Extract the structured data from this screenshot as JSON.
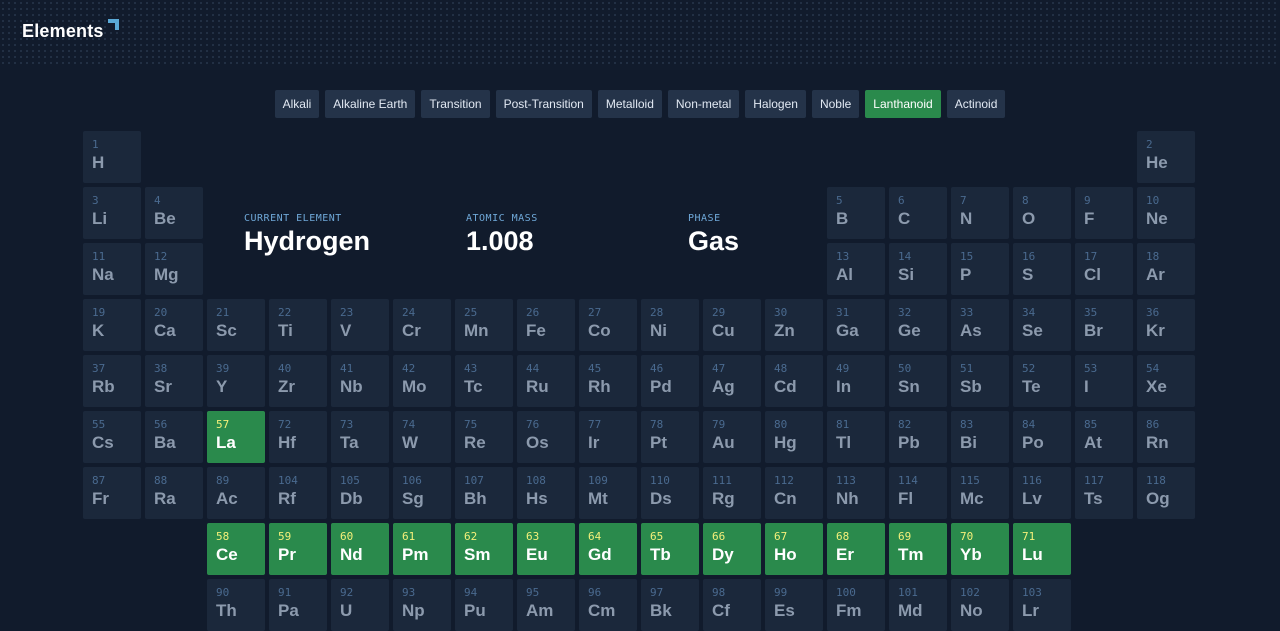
{
  "header": {
    "logo_text": "Elements"
  },
  "filters": [
    {
      "label": "Alkali",
      "active": false
    },
    {
      "label": "Alkaline Earth",
      "active": false
    },
    {
      "label": "Transition",
      "active": false
    },
    {
      "label": "Post-Transition",
      "active": false
    },
    {
      "label": "Metalloid",
      "active": false
    },
    {
      "label": "Non-metal",
      "active": false
    },
    {
      "label": "Halogen",
      "active": false
    },
    {
      "label": "Noble",
      "active": false
    },
    {
      "label": "Lanthanoid",
      "active": true
    },
    {
      "label": "Actinoid",
      "active": false
    }
  ],
  "current": {
    "element_label": "CURRENT ELEMENT",
    "element_value": "Hydrogen",
    "mass_label": "ATOMIC MASS",
    "mass_value": "1.008",
    "phase_label": "PHASE",
    "phase_value": "Gas"
  },
  "colors": {
    "background": "#111b2c",
    "cell": "#1b283b",
    "highlight": "#2a8a4c",
    "highlight_number": "#f4f07a"
  },
  "elements": [
    {
      "n": 1,
      "s": "H",
      "r": 1,
      "c": 1
    },
    {
      "n": 2,
      "s": "He",
      "r": 1,
      "c": 18
    },
    {
      "n": 3,
      "s": "Li",
      "r": 2,
      "c": 1
    },
    {
      "n": 4,
      "s": "Be",
      "r": 2,
      "c": 2
    },
    {
      "n": 5,
      "s": "B",
      "r": 2,
      "c": 13
    },
    {
      "n": 6,
      "s": "C",
      "r": 2,
      "c": 14
    },
    {
      "n": 7,
      "s": "N",
      "r": 2,
      "c": 15
    },
    {
      "n": 8,
      "s": "O",
      "r": 2,
      "c": 16
    },
    {
      "n": 9,
      "s": "F",
      "r": 2,
      "c": 17
    },
    {
      "n": 10,
      "s": "Ne",
      "r": 2,
      "c": 18
    },
    {
      "n": 11,
      "s": "Na",
      "r": 3,
      "c": 1
    },
    {
      "n": 12,
      "s": "Mg",
      "r": 3,
      "c": 2
    },
    {
      "n": 13,
      "s": "Al",
      "r": 3,
      "c": 13
    },
    {
      "n": 14,
      "s": "Si",
      "r": 3,
      "c": 14
    },
    {
      "n": 15,
      "s": "P",
      "r": 3,
      "c": 15
    },
    {
      "n": 16,
      "s": "S",
      "r": 3,
      "c": 16
    },
    {
      "n": 17,
      "s": "Cl",
      "r": 3,
      "c": 17
    },
    {
      "n": 18,
      "s": "Ar",
      "r": 3,
      "c": 18
    },
    {
      "n": 19,
      "s": "K",
      "r": 4,
      "c": 1
    },
    {
      "n": 20,
      "s": "Ca",
      "r": 4,
      "c": 2
    },
    {
      "n": 21,
      "s": "Sc",
      "r": 4,
      "c": 3
    },
    {
      "n": 22,
      "s": "Ti",
      "r": 4,
      "c": 4
    },
    {
      "n": 23,
      "s": "V",
      "r": 4,
      "c": 5
    },
    {
      "n": 24,
      "s": "Cr",
      "r": 4,
      "c": 6
    },
    {
      "n": 25,
      "s": "Mn",
      "r": 4,
      "c": 7
    },
    {
      "n": 26,
      "s": "Fe",
      "r": 4,
      "c": 8
    },
    {
      "n": 27,
      "s": "Co",
      "r": 4,
      "c": 9
    },
    {
      "n": 28,
      "s": "Ni",
      "r": 4,
      "c": 10
    },
    {
      "n": 29,
      "s": "Cu",
      "r": 4,
      "c": 11
    },
    {
      "n": 30,
      "s": "Zn",
      "r": 4,
      "c": 12
    },
    {
      "n": 31,
      "s": "Ga",
      "r": 4,
      "c": 13
    },
    {
      "n": 32,
      "s": "Ge",
      "r": 4,
      "c": 14
    },
    {
      "n": 33,
      "s": "As",
      "r": 4,
      "c": 15
    },
    {
      "n": 34,
      "s": "Se",
      "r": 4,
      "c": 16
    },
    {
      "n": 35,
      "s": "Br",
      "r": 4,
      "c": 17
    },
    {
      "n": 36,
      "s": "Kr",
      "r": 4,
      "c": 18
    },
    {
      "n": 37,
      "s": "Rb",
      "r": 5,
      "c": 1
    },
    {
      "n": 38,
      "s": "Sr",
      "r": 5,
      "c": 2
    },
    {
      "n": 39,
      "s": "Y",
      "r": 5,
      "c": 3
    },
    {
      "n": 40,
      "s": "Zr",
      "r": 5,
      "c": 4
    },
    {
      "n": 41,
      "s": "Nb",
      "r": 5,
      "c": 5
    },
    {
      "n": 42,
      "s": "Mo",
      "r": 5,
      "c": 6
    },
    {
      "n": 43,
      "s": "Tc",
      "r": 5,
      "c": 7
    },
    {
      "n": 44,
      "s": "Ru",
      "r": 5,
      "c": 8
    },
    {
      "n": 45,
      "s": "Rh",
      "r": 5,
      "c": 9
    },
    {
      "n": 46,
      "s": "Pd",
      "r": 5,
      "c": 10
    },
    {
      "n": 47,
      "s": "Ag",
      "r": 5,
      "c": 11
    },
    {
      "n": 48,
      "s": "Cd",
      "r": 5,
      "c": 12
    },
    {
      "n": 49,
      "s": "In",
      "r": 5,
      "c": 13
    },
    {
      "n": 50,
      "s": "Sn",
      "r": 5,
      "c": 14
    },
    {
      "n": 51,
      "s": "Sb",
      "r": 5,
      "c": 15
    },
    {
      "n": 52,
      "s": "Te",
      "r": 5,
      "c": 16
    },
    {
      "n": 53,
      "s": "I",
      "r": 5,
      "c": 17
    },
    {
      "n": 54,
      "s": "Xe",
      "r": 5,
      "c": 18
    },
    {
      "n": 55,
      "s": "Cs",
      "r": 6,
      "c": 1
    },
    {
      "n": 56,
      "s": "Ba",
      "r": 6,
      "c": 2
    },
    {
      "n": 57,
      "s": "La",
      "r": 6,
      "c": 3,
      "hl": true
    },
    {
      "n": 72,
      "s": "Hf",
      "r": 6,
      "c": 4
    },
    {
      "n": 73,
      "s": "Ta",
      "r": 6,
      "c": 5
    },
    {
      "n": 74,
      "s": "W",
      "r": 6,
      "c": 6
    },
    {
      "n": 75,
      "s": "Re",
      "r": 6,
      "c": 7
    },
    {
      "n": 76,
      "s": "Os",
      "r": 6,
      "c": 8
    },
    {
      "n": 77,
      "s": "Ir",
      "r": 6,
      "c": 9
    },
    {
      "n": 78,
      "s": "Pt",
      "r": 6,
      "c": 10
    },
    {
      "n": 79,
      "s": "Au",
      "r": 6,
      "c": 11
    },
    {
      "n": 80,
      "s": "Hg",
      "r": 6,
      "c": 12
    },
    {
      "n": 81,
      "s": "Tl",
      "r": 6,
      "c": 13
    },
    {
      "n": 82,
      "s": "Pb",
      "r": 6,
      "c": 14
    },
    {
      "n": 83,
      "s": "Bi",
      "r": 6,
      "c": 15
    },
    {
      "n": 84,
      "s": "Po",
      "r": 6,
      "c": 16
    },
    {
      "n": 85,
      "s": "At",
      "r": 6,
      "c": 17
    },
    {
      "n": 86,
      "s": "Rn",
      "r": 6,
      "c": 18
    },
    {
      "n": 87,
      "s": "Fr",
      "r": 7,
      "c": 1
    },
    {
      "n": 88,
      "s": "Ra",
      "r": 7,
      "c": 2
    },
    {
      "n": 89,
      "s": "Ac",
      "r": 7,
      "c": 3
    },
    {
      "n": 104,
      "s": "Rf",
      "r": 7,
      "c": 4
    },
    {
      "n": 105,
      "s": "Db",
      "r": 7,
      "c": 5
    },
    {
      "n": 106,
      "s": "Sg",
      "r": 7,
      "c": 6
    },
    {
      "n": 107,
      "s": "Bh",
      "r": 7,
      "c": 7
    },
    {
      "n": 108,
      "s": "Hs",
      "r": 7,
      "c": 8
    },
    {
      "n": 109,
      "s": "Mt",
      "r": 7,
      "c": 9
    },
    {
      "n": 110,
      "s": "Ds",
      "r": 7,
      "c": 10
    },
    {
      "n": 111,
      "s": "Rg",
      "r": 7,
      "c": 11
    },
    {
      "n": 112,
      "s": "Cn",
      "r": 7,
      "c": 12
    },
    {
      "n": 113,
      "s": "Nh",
      "r": 7,
      "c": 13
    },
    {
      "n": 114,
      "s": "Fl",
      "r": 7,
      "c": 14
    },
    {
      "n": 115,
      "s": "Mc",
      "r": 7,
      "c": 15
    },
    {
      "n": 116,
      "s": "Lv",
      "r": 7,
      "c": 16
    },
    {
      "n": 117,
      "s": "Ts",
      "r": 7,
      "c": 17
    },
    {
      "n": 118,
      "s": "Og",
      "r": 7,
      "c": 18
    },
    {
      "n": 58,
      "s": "Ce",
      "r": 8,
      "c": 3,
      "hl": true
    },
    {
      "n": 59,
      "s": "Pr",
      "r": 8,
      "c": 4,
      "hl": true
    },
    {
      "n": 60,
      "s": "Nd",
      "r": 8,
      "c": 5,
      "hl": true
    },
    {
      "n": 61,
      "s": "Pm",
      "r": 8,
      "c": 6,
      "hl": true
    },
    {
      "n": 62,
      "s": "Sm",
      "r": 8,
      "c": 7,
      "hl": true
    },
    {
      "n": 63,
      "s": "Eu",
      "r": 8,
      "c": 8,
      "hl": true
    },
    {
      "n": 64,
      "s": "Gd",
      "r": 8,
      "c": 9,
      "hl": true
    },
    {
      "n": 65,
      "s": "Tb",
      "r": 8,
      "c": 10,
      "hl": true
    },
    {
      "n": 66,
      "s": "Dy",
      "r": 8,
      "c": 11,
      "hl": true
    },
    {
      "n": 67,
      "s": "Ho",
      "r": 8,
      "c": 12,
      "hl": true
    },
    {
      "n": 68,
      "s": "Er",
      "r": 8,
      "c": 13,
      "hl": true
    },
    {
      "n": 69,
      "s": "Tm",
      "r": 8,
      "c": 14,
      "hl": true
    },
    {
      "n": 70,
      "s": "Yb",
      "r": 8,
      "c": 15,
      "hl": true
    },
    {
      "n": 71,
      "s": "Lu",
      "r": 8,
      "c": 16,
      "hl": true
    },
    {
      "n": 90,
      "s": "Th",
      "r": 9,
      "c": 3
    },
    {
      "n": 91,
      "s": "Pa",
      "r": 9,
      "c": 4
    },
    {
      "n": 92,
      "s": "U",
      "r": 9,
      "c": 5
    },
    {
      "n": 93,
      "s": "Np",
      "r": 9,
      "c": 6
    },
    {
      "n": 94,
      "s": "Pu",
      "r": 9,
      "c": 7
    },
    {
      "n": 95,
      "s": "Am",
      "r": 9,
      "c": 8
    },
    {
      "n": 96,
      "s": "Cm",
      "r": 9,
      "c": 9
    },
    {
      "n": 97,
      "s": "Bk",
      "r": 9,
      "c": 10
    },
    {
      "n": 98,
      "s": "Cf",
      "r": 9,
      "c": 11
    },
    {
      "n": 99,
      "s": "Es",
      "r": 9,
      "c": 12
    },
    {
      "n": 100,
      "s": "Fm",
      "r": 9,
      "c": 13
    },
    {
      "n": 101,
      "s": "Md",
      "r": 9,
      "c": 14
    },
    {
      "n": 102,
      "s": "No",
      "r": 9,
      "c": 15
    },
    {
      "n": 103,
      "s": "Lr",
      "r": 9,
      "c": 16
    }
  ]
}
